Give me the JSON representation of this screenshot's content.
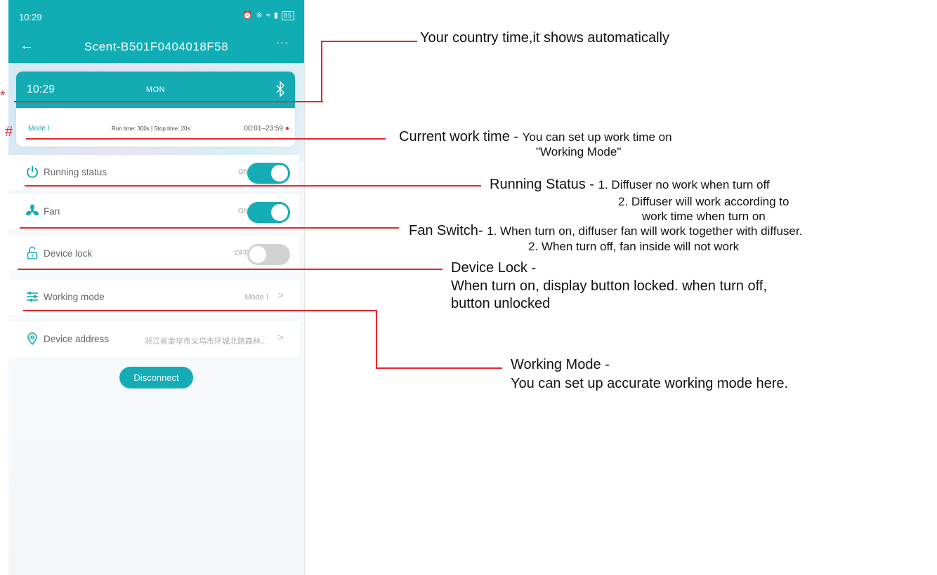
{
  "status_bar": {
    "time": "10:29",
    "battery": "85"
  },
  "nav": {
    "title": "Scent-B501F0404018F58",
    "back_icon": "←",
    "more_icon": "···"
  },
  "time_card": {
    "time": "10:29",
    "day": "MON",
    "mode": "Mode I",
    "run_info": "Run time:  300s   |   Stop time:  20s",
    "time_range": "00:01–23:59"
  },
  "rows": {
    "running_status": {
      "label": "Running status",
      "status": "ON"
    },
    "fan": {
      "label": "Fan",
      "status": "ON"
    },
    "device_lock": {
      "label": "Device lock",
      "status": "OFF"
    },
    "working_mode": {
      "label": "Working mode",
      "value": "Mode I",
      "chevron": ">"
    },
    "device_address": {
      "label": "Device address",
      "value": "浙江省金华市义乌市环城北路森林...",
      "chevron": ">"
    }
  },
  "disconnect_label": "Disconnect",
  "annotations": {
    "country_time": "Your country time,it shows automatically",
    "work_time_title": "Current work time - ",
    "work_time_text": "You can set up work time on",
    "work_time_text2": "\"Working Mode\"",
    "running_title": "Running Status - ",
    "running_line1": "1. Diffuser no work when turn off",
    "running_line2": "2. Diffuser will work according to",
    "running_line3": "work time when turn on",
    "fan_title": "Fan Switch- ",
    "fan_line1": "1. When turn on, diffuser fan will work together with diffuser.",
    "fan_line2": "2.  When turn off, fan inside will not work",
    "lock_title": "Device Lock -",
    "lock_line1": "When turn on, display button locked. when turn off,",
    "lock_line2": "button unlocked",
    "mode_title": "Working Mode -",
    "mode_line1": "You can set up accurate working mode here.",
    "marker_star": "*",
    "marker_hash": "#"
  },
  "colors": {
    "accent": "#15adb5",
    "annotation_red": "#e8252c"
  }
}
